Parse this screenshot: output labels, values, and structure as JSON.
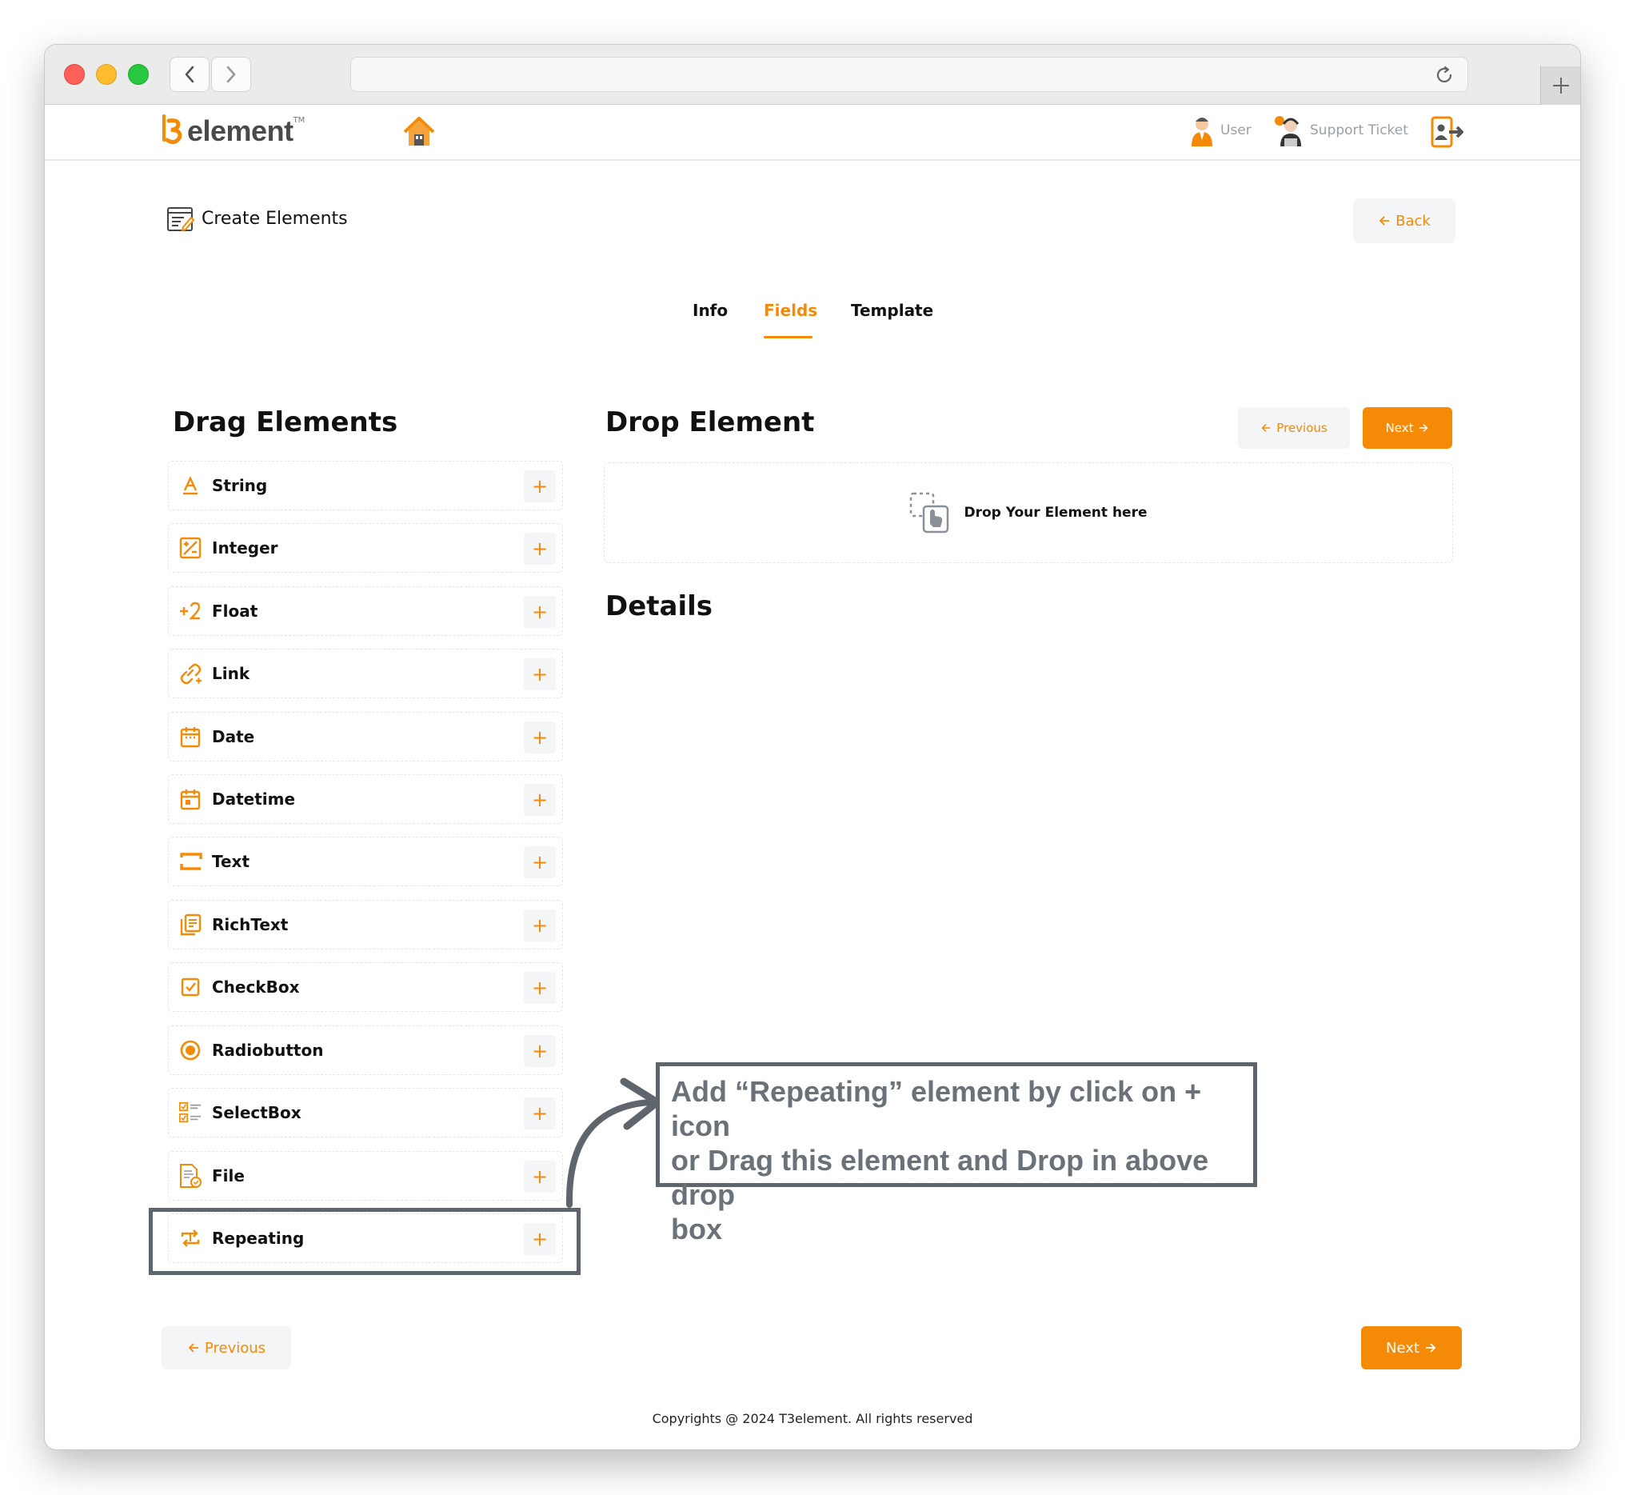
{
  "header": {
    "logo_text": "element",
    "logo_tm": "TM",
    "user_label": "User",
    "support_label": "Support Ticket"
  },
  "page": {
    "title": "Create Elements",
    "back_label": "Back"
  },
  "tabs": [
    {
      "label": "Info",
      "active": false
    },
    {
      "label": "Fields",
      "active": true
    },
    {
      "label": "Template",
      "active": false
    }
  ],
  "drag": {
    "heading": "Drag Elements",
    "items": [
      {
        "label": "String",
        "icon": "string-icon"
      },
      {
        "label": "Integer",
        "icon": "integer-icon"
      },
      {
        "label": "Float",
        "icon": "float-icon"
      },
      {
        "label": "Link",
        "icon": "link-icon"
      },
      {
        "label": "Date",
        "icon": "calendar-icon"
      },
      {
        "label": "Datetime",
        "icon": "calendar-clock-icon"
      },
      {
        "label": "Text",
        "icon": "text-icon"
      },
      {
        "label": "RichText",
        "icon": "richtext-icon"
      },
      {
        "label": "CheckBox",
        "icon": "checkbox-icon"
      },
      {
        "label": "Radiobutton",
        "icon": "radio-icon"
      },
      {
        "label": "SelectBox",
        "icon": "selectbox-icon"
      },
      {
        "label": "File",
        "icon": "file-icon"
      },
      {
        "label": "Repeating",
        "icon": "repeat-icon"
      }
    ],
    "add_symbol": "+"
  },
  "drop": {
    "heading": "Drop Element",
    "placeholder": "Drop Your Element here",
    "previous_label": "Previous",
    "next_label": "Next"
  },
  "details": {
    "heading": "Details"
  },
  "annotation": {
    "line1": "Add “Repeating” element by click on + icon",
    "line2": "or Drag this element and Drop in above drop",
    "line3": "box"
  },
  "nav": {
    "previous_label": "Previous",
    "next_label": "Next"
  },
  "footer": {
    "text": "Copyrights @ 2024 T3element. All rights reserved"
  },
  "colors": {
    "accent": "#f58a07",
    "annotation": "#5e656d",
    "button_bg": "#f3f5f7"
  }
}
